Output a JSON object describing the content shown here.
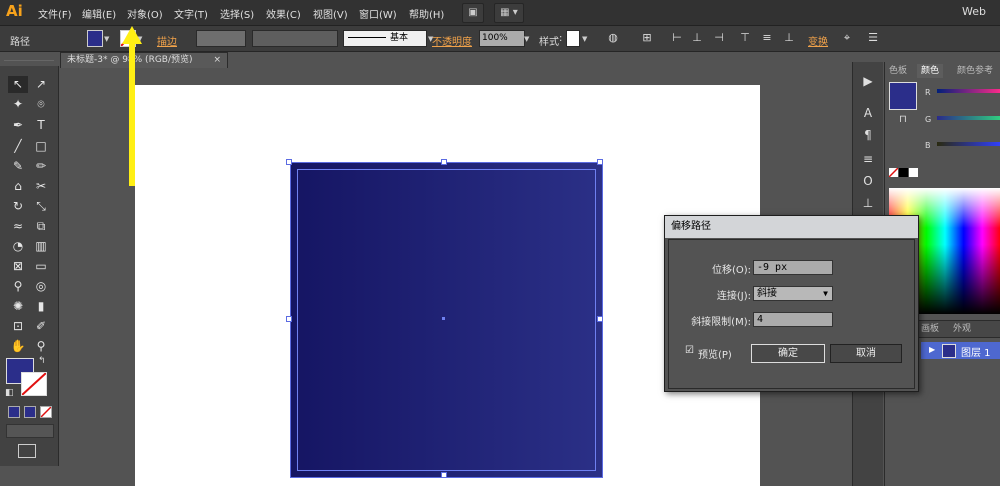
{
  "app": {
    "logo": "Ai",
    "workspace": "Web"
  },
  "menu": [
    "文件(F)",
    "编辑(E)",
    "对象(O)",
    "文字(T)",
    "选择(S)",
    "效果(C)",
    "视图(V)",
    "窗口(W)",
    "帮助(H)"
  ],
  "control": {
    "selection_type": "路径",
    "stroke_label": "描边",
    "stroke_style": "基本",
    "opacity_label": "不透明度",
    "opacity_value": "100%",
    "style_label": "样式",
    "transform_label": "变换"
  },
  "document_tab": {
    "title": "未标题-3* @ 98% (RGB/预览)",
    "close": "×"
  },
  "panels": {
    "color_tabs": [
      "色板",
      "颜色",
      "颜色参考"
    ],
    "channels": [
      "R",
      "G",
      "B"
    ],
    "layers_tabs": [
      "画板",
      "外观"
    ],
    "layer_name": "图层 1",
    "fill_color": "#2b2e8a"
  },
  "dialog": {
    "title": "偏移路径",
    "offset_label": "位移(O):",
    "offset_value": "-9 px",
    "join_label": "连接(J):",
    "join_value": "斜接",
    "miter_label": "斜接限制(M):",
    "miter_value": "4",
    "preview_label": "预览(P)",
    "ok_label": "确定",
    "cancel_label": "取消"
  },
  "colors": {
    "accent": "#f7a21b",
    "shape_fill": "#1f2275"
  }
}
